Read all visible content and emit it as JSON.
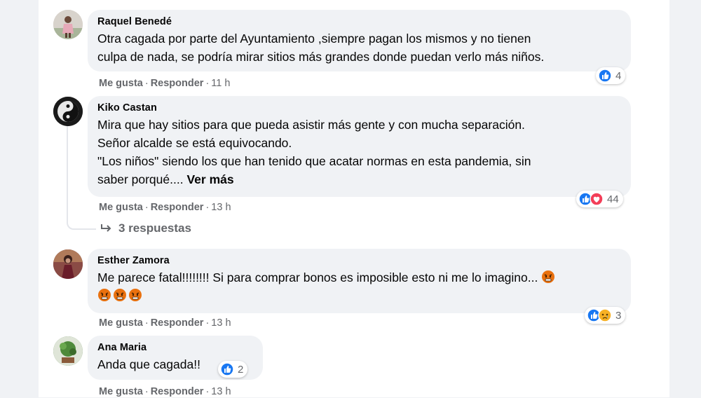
{
  "comments": [
    {
      "author": "Raquel Benedé",
      "lines": [
        "Otra cagada por parte del Ayuntamiento ,siempre pagan los mismos y no tienen",
        "culpa de nada, se podría mirar sitios más grandes donde puedan verlo más niños."
      ],
      "actions": {
        "like": "Me gusta",
        "reply": "Responder",
        "time": "11 h",
        "sep": "·"
      },
      "reactions": {
        "count": "4",
        "icons": [
          "like-icon"
        ]
      }
    },
    {
      "author": "Kiko Castan",
      "lines": [
        "Mira que hay sitios para que pueda asistir más gente y con mucha separación.",
        "Señor alcalde se está equivocando.",
        "\"Los niños\" siendo los que han tenido que acatar normas en esta pandemia, sin",
        "saber porqué.... "
      ],
      "see_more": "Ver más",
      "actions": {
        "like": "Me gusta",
        "reply": "Responder",
        "time": "13 h",
        "sep": "·"
      },
      "reactions": {
        "count": "44",
        "icons": [
          "like-icon",
          "love-icon"
        ]
      },
      "replies_label": "3 respuestas"
    },
    {
      "author": "Esther Zamora",
      "lines": [
        "Me parece fatal!!!!!!!! Si para comprar bonos es imposible esto ni me lo imagino... "
      ],
      "actions": {
        "like": "Me gusta",
        "reply": "Responder",
        "time": "13 h",
        "sep": "·"
      },
      "reactions": {
        "count": "3",
        "icons": [
          "like-icon",
          "sad-icon"
        ]
      }
    },
    {
      "author": "Ana Maria",
      "lines": [
        "Anda que cagada!!"
      ],
      "actions": {
        "like": "Me gusta",
        "reply": "Responder",
        "time": "13 h",
        "sep": "·"
      },
      "reactions": {
        "count": "2",
        "icons": [
          "like-icon"
        ]
      }
    }
  ],
  "colors": {
    "like_blue": "#1877f2",
    "love_red": "#f33e58",
    "sad_yellow": "#f7b125",
    "angry_orange": "#e9710f",
    "muted_text": "#65676b",
    "bubble_bg": "#f0f2f5"
  }
}
